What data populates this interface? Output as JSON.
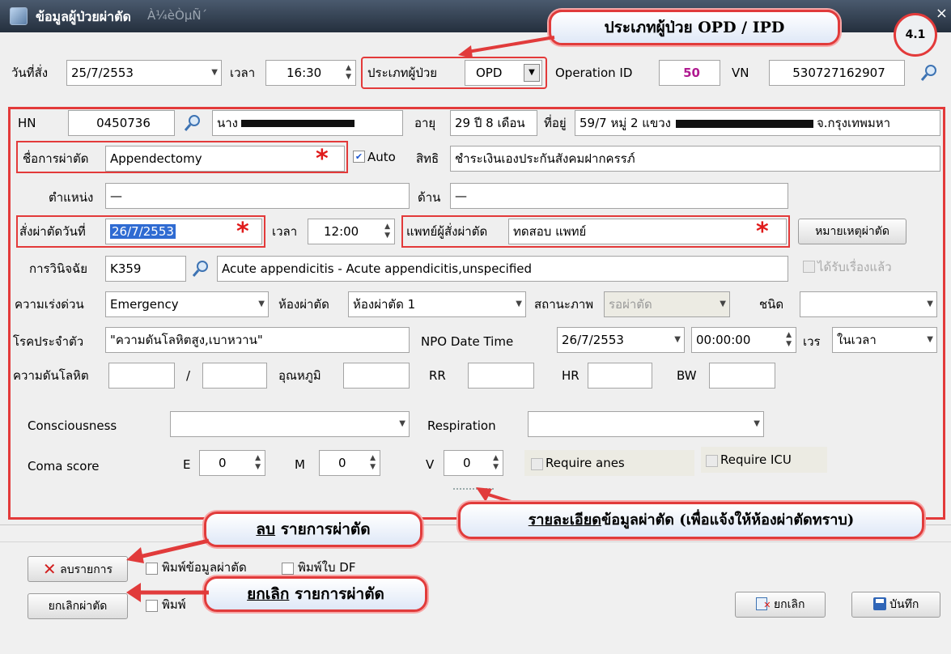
{
  "window": {
    "title": "ข้อมูลผู้ป่วยผ่าตัด",
    "title_ghost": "À¼èÒµÑ´"
  },
  "top_row": {
    "order_date_label": "วันที่สั่ง",
    "order_date": "25/7/2553",
    "time_label": "เวลา",
    "time": "16:30",
    "patient_type_label": "ประเภทผู้ป่วย",
    "patient_type": "OPD",
    "operation_id_label": "Operation ID",
    "operation_id": "50",
    "vn_label": "VN",
    "vn": "530727162907"
  },
  "patient": {
    "hn_label": "HN",
    "hn": "0450736",
    "name": "นาง",
    "age_label": "อายุ",
    "age": "29 ปี 8 เดือน",
    "address_label": "ที่อยู่",
    "address": "59/7 หมู่ 2 แขวง",
    "address_end": "จ.กรุงเทพมหา"
  },
  "surgery": {
    "name_label": "ชื่อการผ่าตัด",
    "name": "Appendectomy",
    "auto_label": "Auto",
    "right_label": "สิทธิ",
    "right": "ชำระเงินเองประกันสังคมฝากครรภ์",
    "position_label": "ตำแหน่ง",
    "position": "—",
    "side_label": "ด้าน",
    "side": "—",
    "order_op_date_label": "สั่งผ่าตัดวันที่",
    "order_op_date": "26/7/2553",
    "time_label": "เวลา",
    "time": "12:00",
    "doctor_label": "แพทย์ผู้สั่งผ่าตัด",
    "doctor": "ทดสอบ แพทย์",
    "note_button": "หมายเหตุผ่าตัด",
    "diag_label": "การวินิจฉัย",
    "diag_code": "K359",
    "diag_text": "Acute appendicitis - Acute appendicitis,unspecified",
    "received_label": "ได้รับเรื่องแล้ว",
    "urgency_label": "ความเร่งด่วน",
    "urgency": "Emergency",
    "room_label": "ห้องผ่าตัด",
    "room": "ห้องผ่าตัด 1",
    "status_label": "สถานะภาพ",
    "status": "รอผ่าตัด",
    "type_label": "ชนิด",
    "type": "",
    "disease_label": "โรคประจำตัว",
    "disease": "\"ความดันโลหิตสูง,เบาหวาน\"",
    "npo_label": "NPO Date Time",
    "npo_date": "26/7/2553",
    "npo_time": "00:00:00",
    "shift_label": "เวร",
    "shift": "ในเวลา",
    "bp_label": "ความดันโลหิต",
    "bp_sep": "/",
    "temp_label": "อุณหภูมิ",
    "rr_label": "RR",
    "hr_label": "HR",
    "bw_label": "BW",
    "consciousness_label": "Consciousness",
    "respiration_label": "Respiration",
    "coma_label": "Coma score",
    "e_label": "E",
    "e_value": "0",
    "m_label": "M",
    "m_value": "0",
    "v_label": "V",
    "v_value": "0",
    "req_anes_label": "Require anes",
    "req_icu_label": "Require ICU"
  },
  "bottom": {
    "delete_button": "ลบรายการ",
    "print_surgery": "พิมพ์ข้อมูลผ่าตัด",
    "print_df": "พิมพ์ใบ DF",
    "cancel_surgery_button": "ยกเลิกผ่าตัด",
    "print_hidden": "พิมพ์",
    "cancel_button": "ยกเลิก",
    "save_button": "บันทึก"
  },
  "callouts": {
    "patient_type": "ประเภทผู้ป่วย OPD / IPD",
    "badge": "4.1",
    "delete_emph": "ลบ",
    "delete_rest": " รายการผ่าตัด",
    "cancel_emph": "ยกเลิก",
    "cancel_rest": " รายการผ่าตัด",
    "detail_emph": "รายละเอียด",
    "detail_rest": "ข้อมูลผ่าตัด (เพื่อแจ้งให้ห้องผ่าตัดทราบ)"
  }
}
